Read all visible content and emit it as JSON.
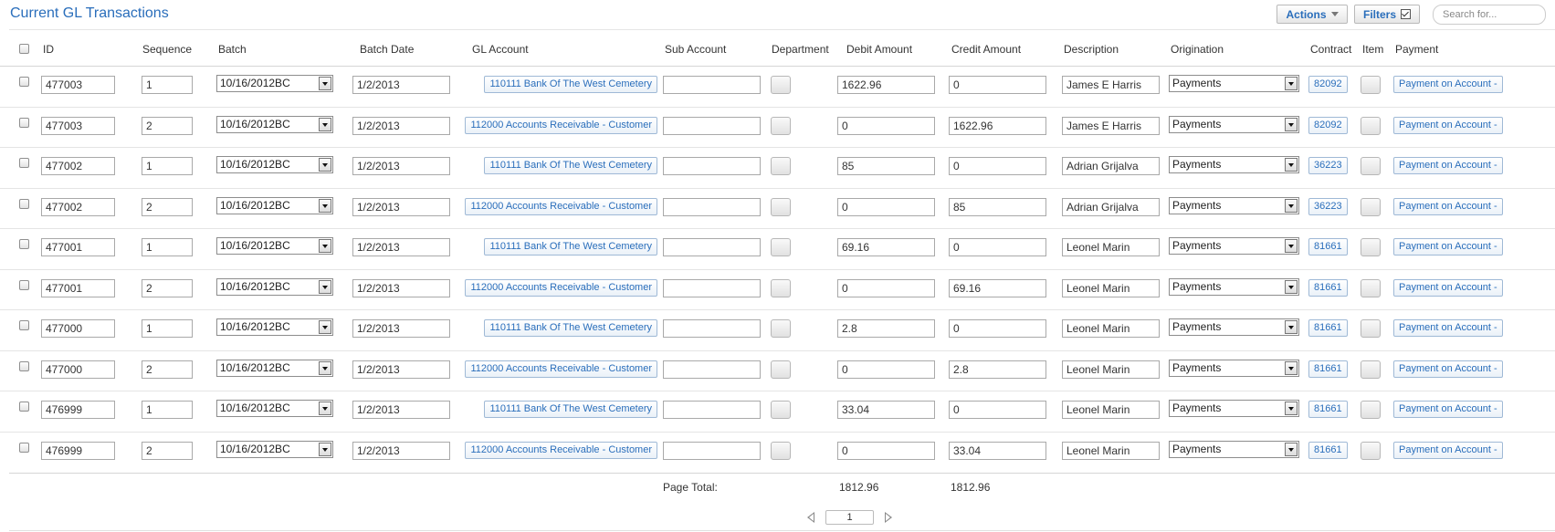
{
  "header": {
    "title": "Current GL Transactions",
    "actions_label": "Actions",
    "filters_label": "Filters",
    "search_placeholder": "Search for..."
  },
  "columns": {
    "id": "ID",
    "sequence": "Sequence",
    "batch": "Batch",
    "batch_date": "Batch Date",
    "gl_account": "GL Account",
    "sub_account": "Sub Account",
    "department": "Department",
    "debit_amount": "Debit Amount",
    "credit_amount": "Credit Amount",
    "description": "Description",
    "origination": "Origination",
    "contract": "Contract",
    "item": "Item",
    "payment": "Payment"
  },
  "rows": [
    {
      "id": "477003",
      "sequence": "1",
      "batch": "10/16/2012BC",
      "batch_date": "1/2/2013",
      "gl_account": "110111 Bank Of The West Cemetery",
      "sub_account": "",
      "debit": "1622.96",
      "credit": "0",
      "description": "James E Harris",
      "origination": "Payments",
      "contract": "82092",
      "payment": "Payment on Account -"
    },
    {
      "id": "477003",
      "sequence": "2",
      "batch": "10/16/2012BC",
      "batch_date": "1/2/2013",
      "gl_account": "112000 Accounts Receivable - Customer",
      "sub_account": "",
      "debit": "0",
      "credit": "1622.96",
      "description": "James E Harris",
      "origination": "Payments",
      "contract": "82092",
      "payment": "Payment on Account -"
    },
    {
      "id": "477002",
      "sequence": "1",
      "batch": "10/16/2012BC",
      "batch_date": "1/2/2013",
      "gl_account": "110111 Bank Of The West Cemetery",
      "sub_account": "",
      "debit": "85",
      "credit": "0",
      "description": "Adrian Grijalva",
      "origination": "Payments",
      "contract": "36223",
      "payment": "Payment on Account -"
    },
    {
      "id": "477002",
      "sequence": "2",
      "batch": "10/16/2012BC",
      "batch_date": "1/2/2013",
      "gl_account": "112000 Accounts Receivable - Customer",
      "sub_account": "",
      "debit": "0",
      "credit": "85",
      "description": "Adrian Grijalva",
      "origination": "Payments",
      "contract": "36223",
      "payment": "Payment on Account -"
    },
    {
      "id": "477001",
      "sequence": "1",
      "batch": "10/16/2012BC",
      "batch_date": "1/2/2013",
      "gl_account": "110111 Bank Of The West Cemetery",
      "sub_account": "",
      "debit": "69.16",
      "credit": "0",
      "description": "Leonel Marin",
      "origination": "Payments",
      "contract": "81661",
      "payment": "Payment on Account -"
    },
    {
      "id": "477001",
      "sequence": "2",
      "batch": "10/16/2012BC",
      "batch_date": "1/2/2013",
      "gl_account": "112000 Accounts Receivable - Customer",
      "sub_account": "",
      "debit": "0",
      "credit": "69.16",
      "description": "Leonel Marin",
      "origination": "Payments",
      "contract": "81661",
      "payment": "Payment on Account -"
    },
    {
      "id": "477000",
      "sequence": "1",
      "batch": "10/16/2012BC",
      "batch_date": "1/2/2013",
      "gl_account": "110111 Bank Of The West Cemetery",
      "sub_account": "",
      "debit": "2.8",
      "credit": "0",
      "description": "Leonel Marin",
      "origination": "Payments",
      "contract": "81661",
      "payment": "Payment on Account -"
    },
    {
      "id": "477000",
      "sequence": "2",
      "batch": "10/16/2012BC",
      "batch_date": "1/2/2013",
      "gl_account": "112000 Accounts Receivable - Customer",
      "sub_account": "",
      "debit": "0",
      "credit": "2.8",
      "description": "Leonel Marin",
      "origination": "Payments",
      "contract": "81661",
      "payment": "Payment on Account -"
    },
    {
      "id": "476999",
      "sequence": "1",
      "batch": "10/16/2012BC",
      "batch_date": "1/2/2013",
      "gl_account": "110111 Bank Of The West Cemetery",
      "sub_account": "",
      "debit": "33.04",
      "credit": "0",
      "description": "Leonel Marin",
      "origination": "Payments",
      "contract": "81661",
      "payment": "Payment on Account -"
    },
    {
      "id": "476999",
      "sequence": "2",
      "batch": "10/16/2012BC",
      "batch_date": "1/2/2013",
      "gl_account": "112000 Accounts Receivable - Customer",
      "sub_account": "",
      "debit": "0",
      "credit": "33.04",
      "description": "Leonel Marin",
      "origination": "Payments",
      "contract": "81661",
      "payment": "Payment on Account -"
    }
  ],
  "footer": {
    "page_total_label": "Page Total:",
    "debit_total": "1812.96",
    "credit_total": "1812.96",
    "page": "1"
  },
  "colors": {
    "accent": "#2a6ebb",
    "border": "#a9a9a9"
  }
}
